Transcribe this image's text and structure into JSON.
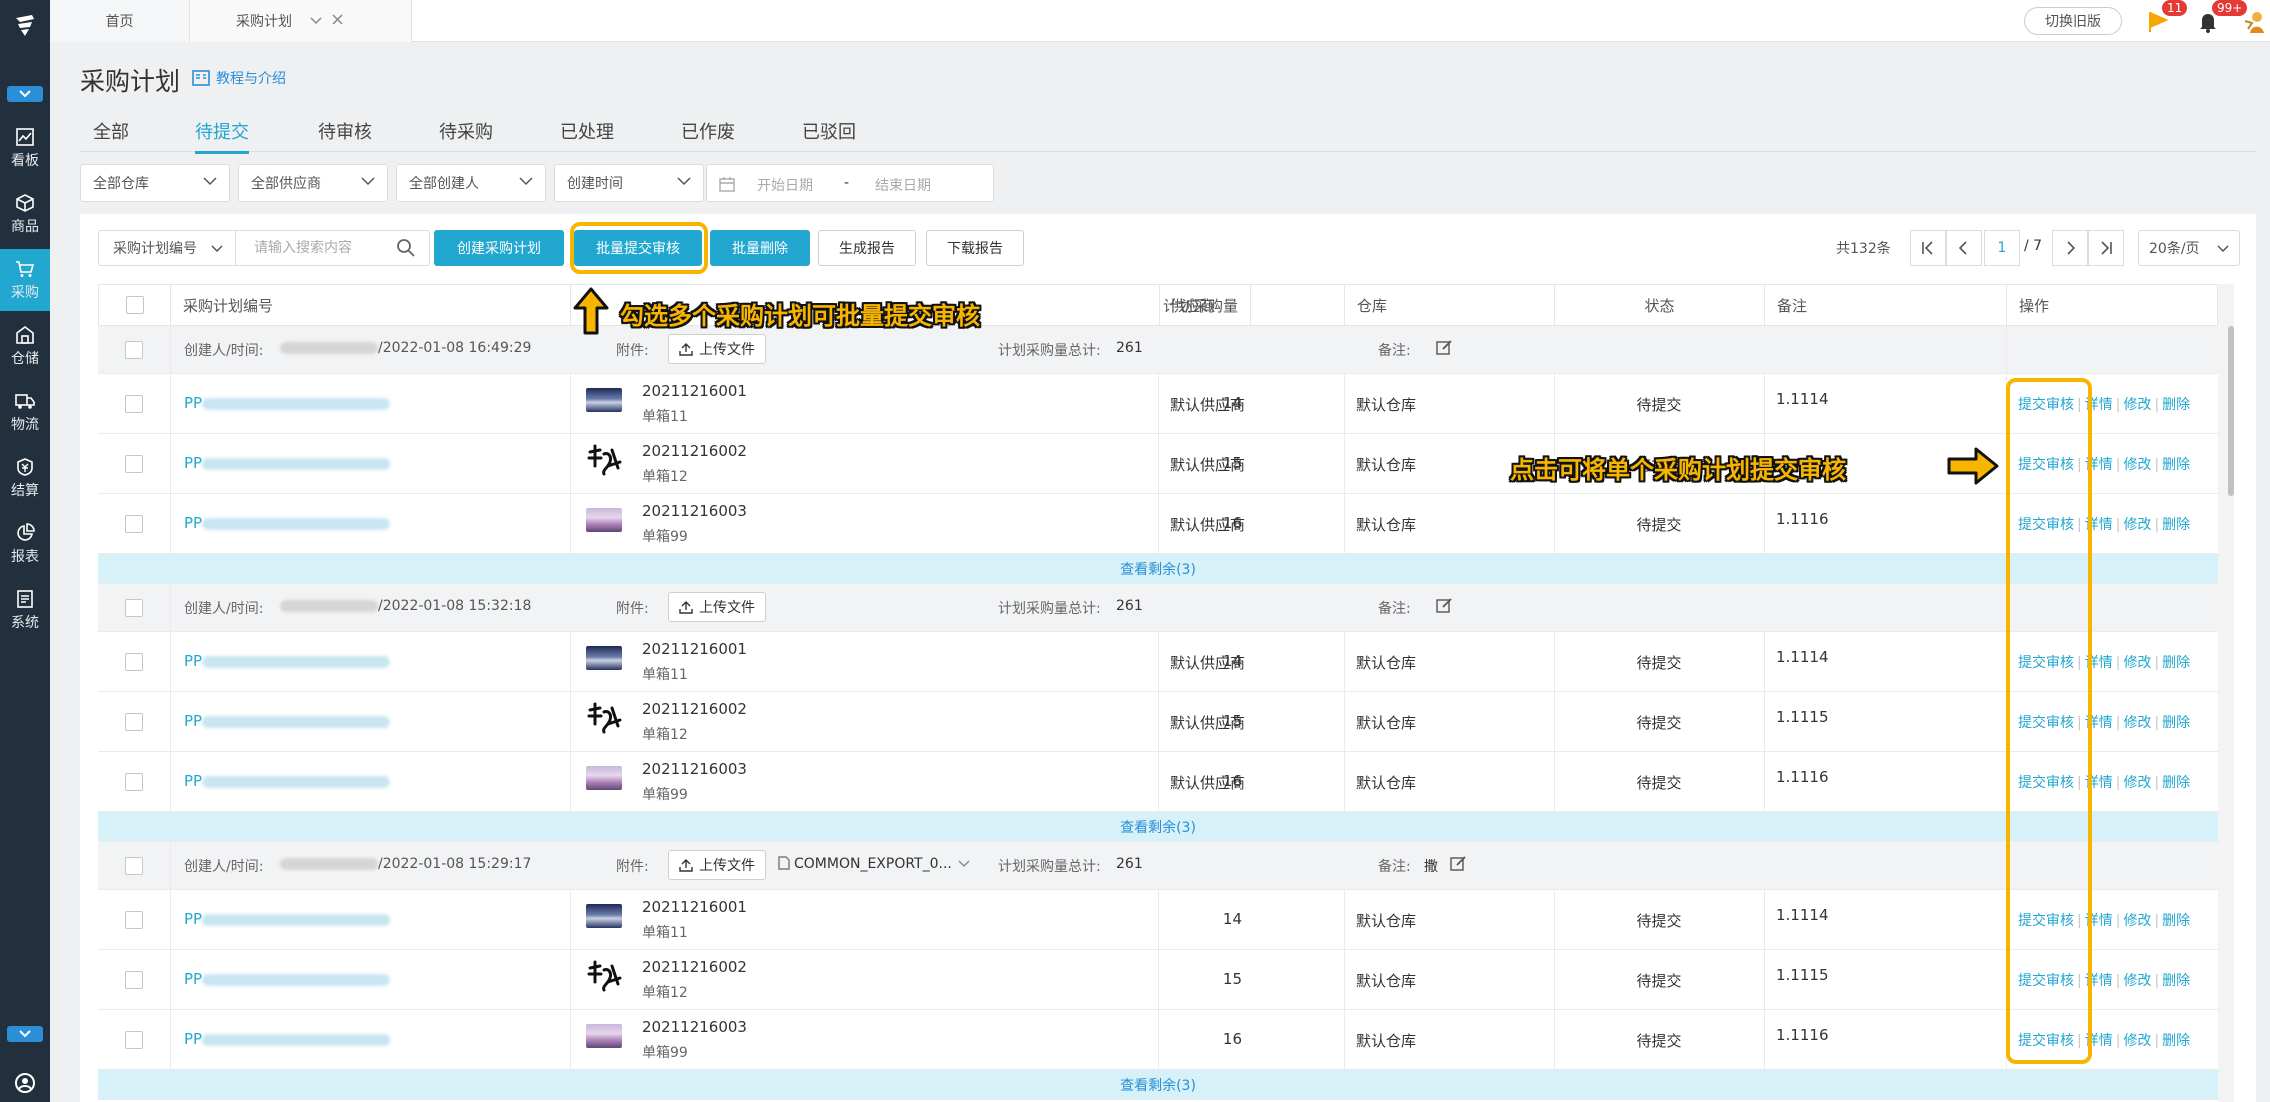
{
  "sidebar": {
    "items": [
      {
        "label": "看板",
        "icon": "chart-line-icon"
      },
      {
        "label": "商品",
        "icon": "cube-icon"
      },
      {
        "label": "采购",
        "icon": "cart-icon"
      },
      {
        "label": "仓储",
        "icon": "warehouse-icon"
      },
      {
        "label": "物流",
        "icon": "truck-icon"
      },
      {
        "label": "结算",
        "icon": "coin-icon"
      },
      {
        "label": "报表",
        "icon": "pie-chart-icon"
      },
      {
        "label": "系统",
        "icon": "system-icon"
      }
    ],
    "active": "采购"
  },
  "topbar": {
    "tabs": [
      {
        "label": "首页"
      },
      {
        "label": "采购计划"
      }
    ],
    "old_version": "切换旧版",
    "flag_badge": "11",
    "bell_badge": "99+"
  },
  "page": {
    "title": "采购计划",
    "tutorial": "教程与介绍"
  },
  "status_tabs": [
    "全部",
    "待提交",
    "待审核",
    "待采购",
    "已处理",
    "已作废",
    "已驳回"
  ],
  "filters": {
    "warehouse": "全部仓库",
    "supplier": "全部供应商",
    "creator": "全部创建人",
    "time_type": "创建时间",
    "start_placeholder": "开始日期",
    "range_sep": "-",
    "end_placeholder": "结束日期"
  },
  "toolbar": {
    "search_type": "采购计划编号",
    "search_placeholder": "请输入搜索内容",
    "create": "创建采购计划",
    "batch_submit": "批量提交审核",
    "batch_delete": "批量删除",
    "report": "生成报告",
    "download": "下载报告"
  },
  "pager": {
    "total": "共132条",
    "current": "1",
    "pages": "/ 7",
    "page_size": "20条/页"
  },
  "table": {
    "headers": [
      "采购计划编号",
      "计划采购量",
      "供应商",
      "仓库",
      "状态",
      "备注",
      "操作"
    ],
    "group_labels": {
      "creator": "创建人/时间:",
      "attachment": "附件:",
      "upload": "上传文件",
      "total": "计划采购量总计:",
      "remark": "备注:"
    },
    "ops": {
      "submit": "提交审核",
      "detail": "详情",
      "edit": "修改",
      "delete": "删除"
    },
    "groups": [
      {
        "time": "/2022-01-08 16:49:29",
        "file": "",
        "total": "261",
        "remark": "",
        "more": "查看剩余(3)",
        "items": [
          {
            "pp": "PP",
            "code": "20211216001",
            "box": "单箱11",
            "qty": "14",
            "supplier": "默认供应商",
            "warehouse": "默认仓库",
            "status": "待提交",
            "remark": "1.1114"
          },
          {
            "pp": "PP",
            "code": "20211216002",
            "box": "单箱12",
            "qty": "15",
            "supplier": "默认供应商",
            "warehouse": "默认仓库",
            "status": "待提交",
            "remark": ""
          },
          {
            "pp": "PP",
            "code": "20211216003",
            "box": "单箱99",
            "qty": "16",
            "supplier": "默认供应商",
            "warehouse": "默认仓库",
            "status": "待提交",
            "remark": "1.1116"
          }
        ]
      },
      {
        "time": "/2022-01-08 15:32:18",
        "file": "",
        "total": "261",
        "remark": "",
        "more": "查看剩余(3)",
        "items": [
          {
            "pp": "PP",
            "code": "20211216001",
            "box": "单箱11",
            "qty": "14",
            "supplier": "默认供应商",
            "warehouse": "默认仓库",
            "status": "待提交",
            "remark": "1.1114"
          },
          {
            "pp": "PP",
            "code": "20211216002",
            "box": "单箱12",
            "qty": "15",
            "supplier": "默认供应商",
            "warehouse": "默认仓库",
            "status": "待提交",
            "remark": "1.1115"
          },
          {
            "pp": "PP",
            "code": "20211216003",
            "box": "单箱99",
            "qty": "16",
            "supplier": "默认供应商",
            "warehouse": "默认仓库",
            "status": "待提交",
            "remark": "1.1116"
          }
        ]
      },
      {
        "time": "/2022-01-08 15:29:17",
        "file": "COMMON_EXPORT_0...",
        "total": "261",
        "remark": "撒",
        "more": "查看剩余(3)",
        "items": [
          {
            "pp": "PP",
            "code": "20211216001",
            "box": "单箱11",
            "qty": "14",
            "supplier": "",
            "warehouse": "默认仓库",
            "status": "待提交",
            "remark": "1.1114"
          },
          {
            "pp": "PP",
            "code": "20211216002",
            "box": "单箱12",
            "qty": "15",
            "supplier": "",
            "warehouse": "默认仓库",
            "status": "待提交",
            "remark": "1.1115"
          },
          {
            "pp": "PP",
            "code": "20211216003",
            "box": "单箱99",
            "qty": "16",
            "supplier": "",
            "warehouse": "默认仓库",
            "status": "待提交",
            "remark": "1.1116"
          }
        ]
      }
    ]
  },
  "annotations": {
    "batch": "勾选多个采购计划可批量提交审核",
    "single": "点击可将单个采购计划提交审核"
  },
  "colors": {
    "primary": "#22a7d0",
    "sidebar": "#22303d",
    "highlight": "#f7b500"
  }
}
